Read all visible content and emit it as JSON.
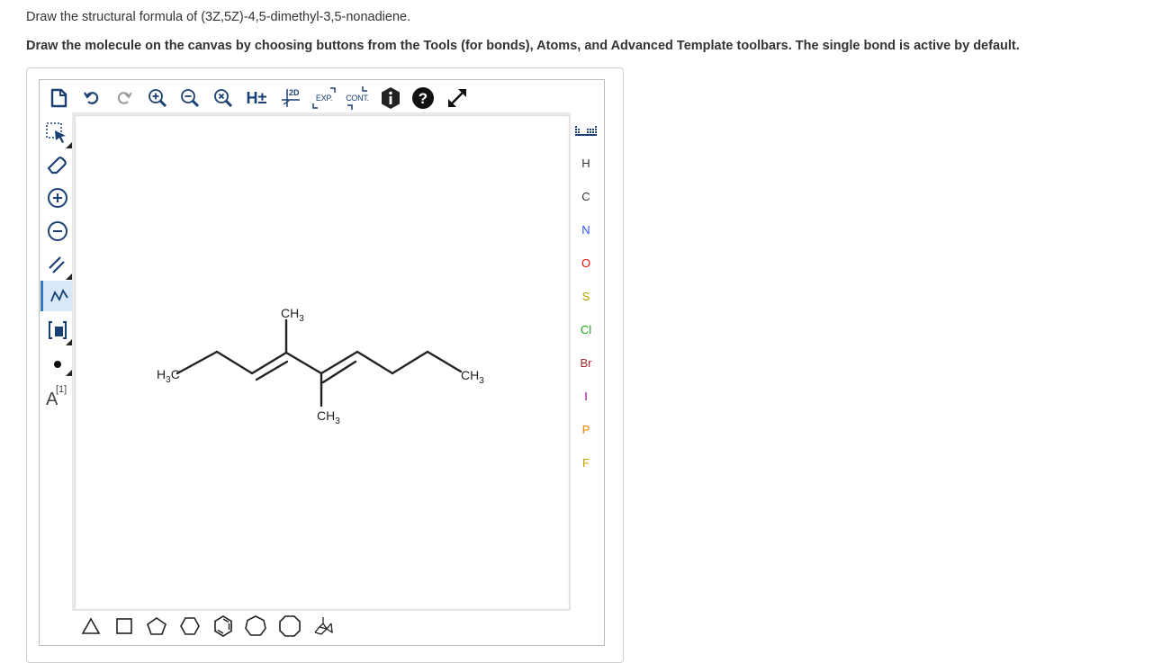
{
  "question": {
    "prompt": "Draw the structural formula of (3Z,5Z)-4,5-dimethyl-3,5-nonadiene.",
    "instructions": "Draw the molecule on the canvas by choosing buttons from the Tools (for bonds), Atoms, and Advanced Template toolbars. The single bond is active by default."
  },
  "top_toolbar": {
    "items": [
      {
        "icon": "new-document-icon"
      },
      {
        "icon": "undo-icon"
      },
      {
        "icon": "redo-icon"
      },
      {
        "icon": "zoom-in-icon"
      },
      {
        "icon": "zoom-out-icon"
      },
      {
        "icon": "zoom-reset-icon"
      },
      {
        "icon": "hydrogen-toggle-icon",
        "label": "H±"
      },
      {
        "icon": "clean-2d-icon",
        "label": "2D"
      },
      {
        "icon": "expand-icon",
        "label": "EXP."
      },
      {
        "icon": "contract-icon",
        "label": "CONT."
      },
      {
        "icon": "info-icon"
      },
      {
        "icon": "help-icon"
      },
      {
        "icon": "fullscreen-icon"
      }
    ]
  },
  "left_toolbar": {
    "items": [
      {
        "icon": "selection-tool-icon"
      },
      {
        "icon": "eraser-icon"
      },
      {
        "icon": "positive-charge-icon"
      },
      {
        "icon": "negative-charge-icon"
      },
      {
        "icon": "bond-type-icon"
      },
      {
        "icon": "chain-tool-icon",
        "active": true
      },
      {
        "icon": "bracket-tool-icon"
      },
      {
        "icon": "lone-pair-icon"
      },
      {
        "icon": "atom-map-icon",
        "label": "A",
        "sup": "[1]"
      }
    ]
  },
  "atoms": {
    "items": [
      {
        "symbol": "H",
        "color": "#333333"
      },
      {
        "symbol": "C",
        "color": "#333333"
      },
      {
        "symbol": "N",
        "color": "#3050f8"
      },
      {
        "symbol": "O",
        "color": "#ff0d0d"
      },
      {
        "symbol": "S",
        "color": "#b8a200"
      },
      {
        "symbol": "Cl",
        "color": "#1ff01f"
      },
      {
        "symbol": "Br",
        "color": "#a62929"
      },
      {
        "symbol": "I",
        "color": "#940094"
      },
      {
        "symbol": "P",
        "color": "#ff8000"
      },
      {
        "symbol": "F",
        "color": "#90e050"
      }
    ]
  },
  "molecule": {
    "labels": {
      "h3c_left": {
        "main": "H",
        "sub": "3",
        "tail": "C"
      },
      "ch3_top": {
        "main": "CH",
        "sub": "3"
      },
      "ch3_right": {
        "main": "CH",
        "sub": "3"
      },
      "ch3_bottom": {
        "main": "CH",
        "sub": "3"
      }
    }
  },
  "templates": {
    "items": [
      {
        "icon": "triangle-template-icon"
      },
      {
        "icon": "square-template-icon"
      },
      {
        "icon": "pentagon-template-icon"
      },
      {
        "icon": "hexagon-template-icon"
      },
      {
        "icon": "benzene-template-icon"
      },
      {
        "icon": "heptagon-template-icon"
      },
      {
        "icon": "octagon-template-icon"
      },
      {
        "icon": "chair-template-icon"
      }
    ]
  }
}
